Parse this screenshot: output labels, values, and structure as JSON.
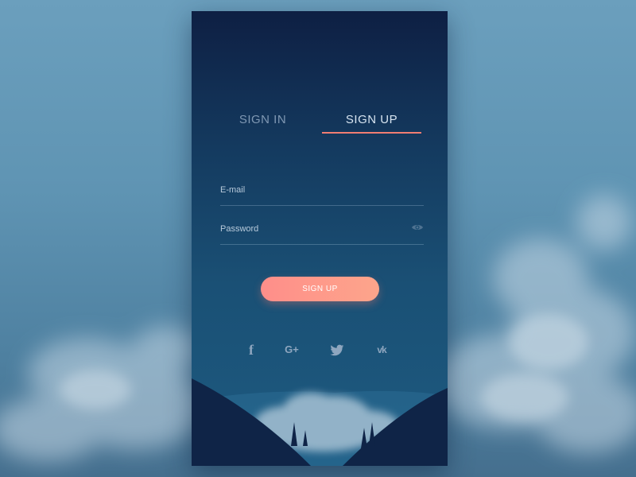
{
  "tabs": [
    {
      "label": "SIGN IN",
      "active": false
    },
    {
      "label": "SIGN UP",
      "active": true
    }
  ],
  "form": {
    "email_placeholder": "E-mail",
    "password_placeholder": "Password",
    "submit_label": "SIGN UP"
  },
  "social": [
    {
      "name": "facebook",
      "glyph": "f"
    },
    {
      "name": "google-plus",
      "glyph": "G+"
    },
    {
      "name": "twitter",
      "glyph": ""
    },
    {
      "name": "vk",
      "glyph": "vk"
    }
  ],
  "colors": {
    "accent": "#f07d72",
    "button_gradient_start": "#fe8e8a",
    "button_gradient_end": "#fda58b",
    "card_top": "#0e1f43",
    "card_bottom": "#1d5a80",
    "mountain": "#0f2447"
  }
}
